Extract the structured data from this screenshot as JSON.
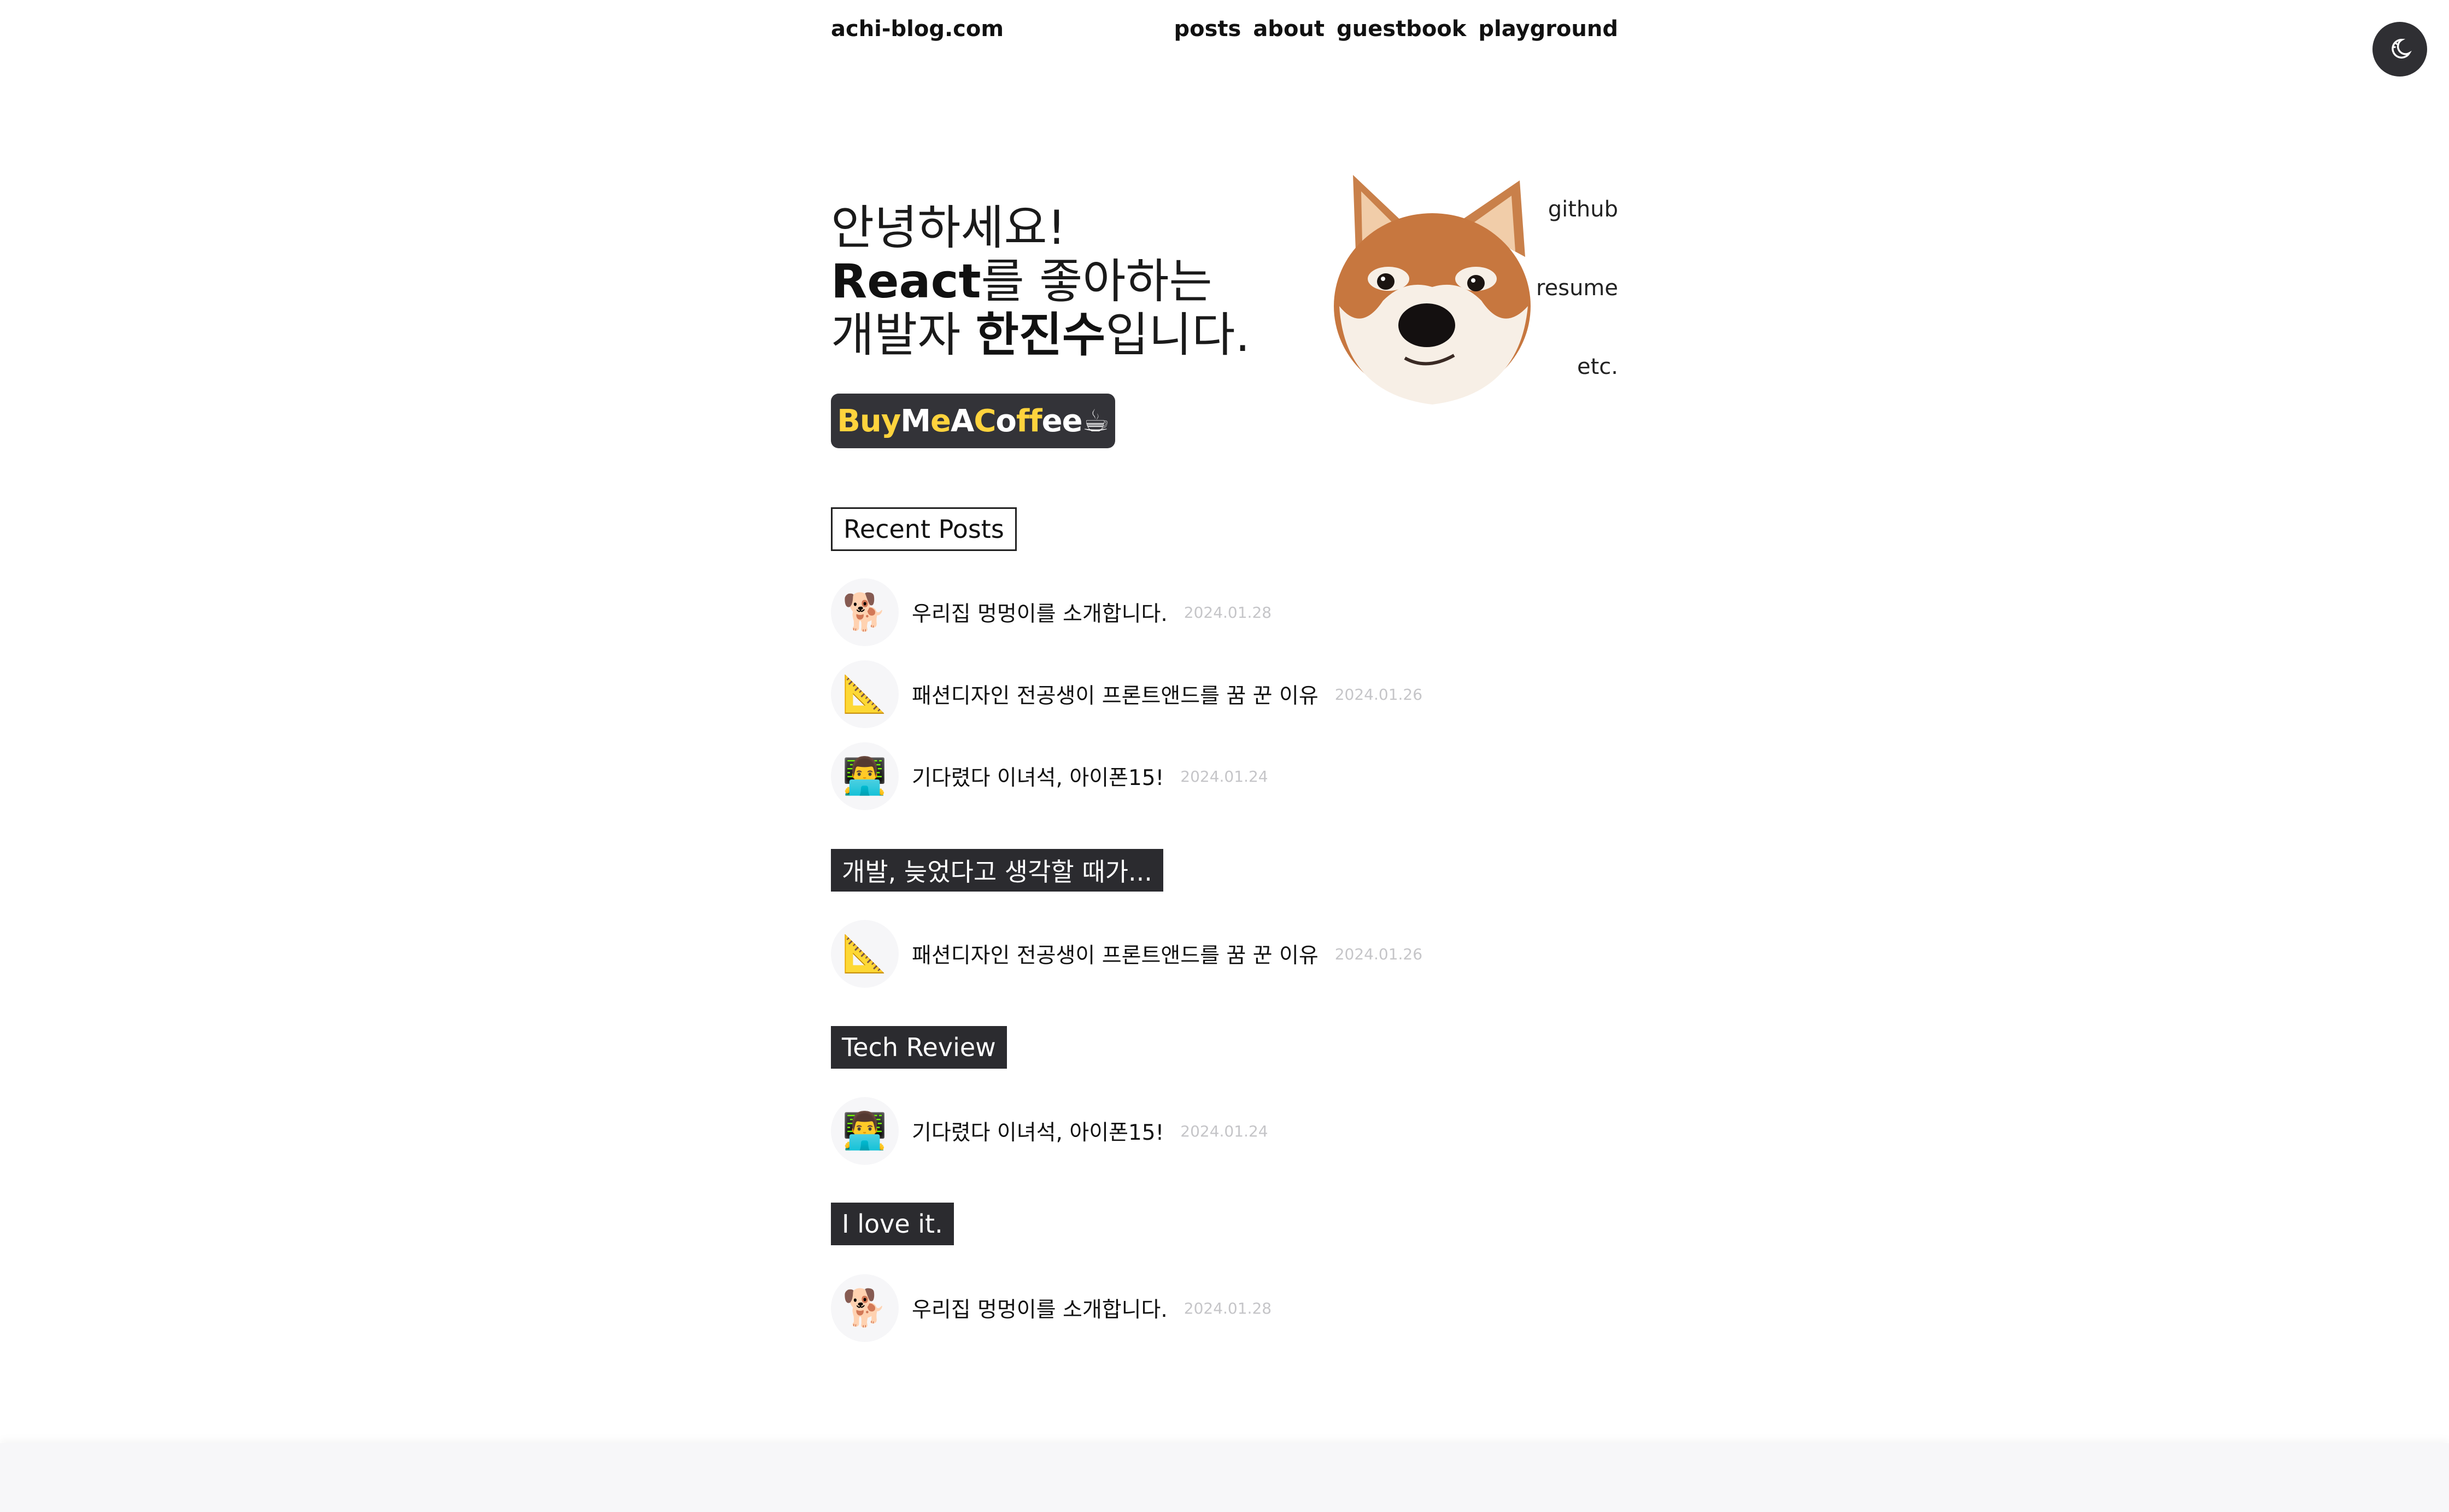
{
  "header": {
    "logo": "achi-blog.com",
    "nav": [
      "posts",
      "about",
      "guestbook",
      "playground"
    ]
  },
  "theme_toggle": {
    "icon": "moon-icon"
  },
  "hero": {
    "line1": "안녕하세요!",
    "line2_strong": "React",
    "line2_rest": "를 좋아하는",
    "line3_pre": "개발자 ",
    "line3_strong": "한진수",
    "line3_rest": "입니다.",
    "button": {
      "parts": [
        "B",
        "uy",
        "M",
        "e",
        "A",
        "C",
        "o",
        "ff",
        "ee",
        "☕"
      ],
      "accent_color": "#ffd33d"
    },
    "avatar_icon": "shiba-dog-face",
    "links": [
      "github",
      "resume",
      "etc."
    ]
  },
  "sections": [
    {
      "title": "Recent Posts",
      "posts": [
        {
          "icon": "🐕",
          "title": "우리집 멍멍이를 소개합니다.",
          "date": "2024.01.28"
        },
        {
          "icon": "📐",
          "title": "패션디자인 전공생이 프론트앤드를 꿈 꾼 이유",
          "date": "2024.01.26"
        },
        {
          "icon": "👨‍💻",
          "title": "기다렸다 이녀석, 아이폰15!",
          "date": "2024.01.24"
        }
      ]
    },
    {
      "title": "개발, 늦었다고 생각할 때가...",
      "posts": [
        {
          "icon": "📐",
          "title": "패션디자인 전공생이 프론트앤드를 꿈 꾼 이유",
          "date": "2024.01.26"
        }
      ]
    },
    {
      "title": "Tech Review",
      "posts": [
        {
          "icon": "👨‍💻",
          "title": "기다렸다 이녀석, 아이폰15!",
          "date": "2024.01.24"
        }
      ]
    },
    {
      "title": "I love it.",
      "posts": [
        {
          "icon": "🐕",
          "title": "우리집 멍멍이를 소개합니다.",
          "date": "2024.01.28"
        }
      ]
    }
  ],
  "colors": {
    "dark": "#2b2b2f",
    "date": "#c5c5c8",
    "footer_bg": "#f7f7f9"
  }
}
